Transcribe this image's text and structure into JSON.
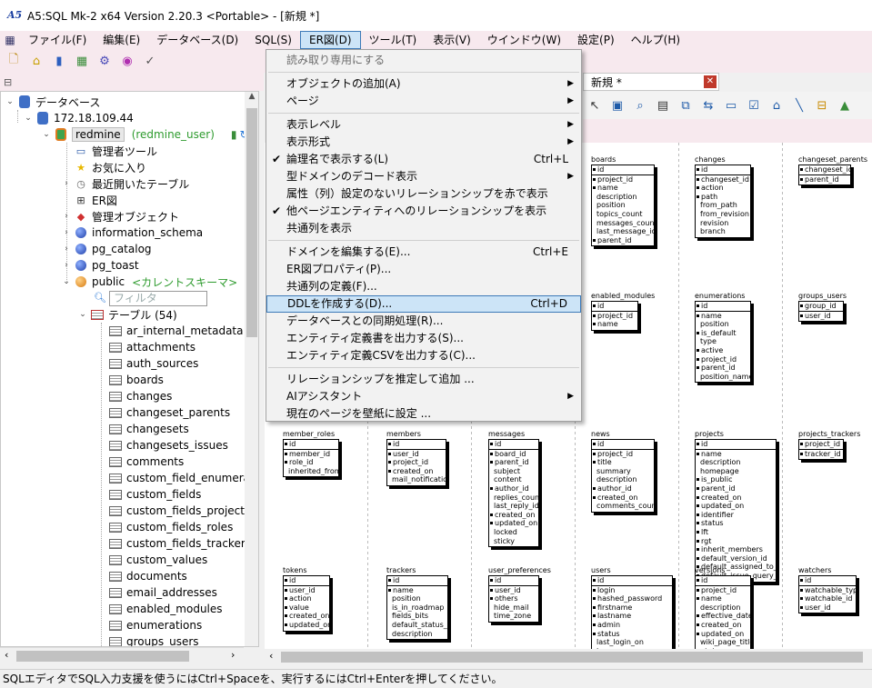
{
  "window": {
    "title": "A5:SQL Mk-2 x64 Version 2.20.3 <Portable> - [新規 *]"
  },
  "menubar": [
    "ファイル(F)",
    "編集(E)",
    "データベース(D)",
    "SQL(S)",
    "ER図(D)",
    "ツール(T)",
    "表示(V)",
    "ウインドウ(W)",
    "設定(P)",
    "ヘルプ(H)"
  ],
  "tree": {
    "root": "データベース",
    "host": "172.18.109.44",
    "connection": "redmine",
    "connection_user": "(redmine_user)",
    "items": [
      "管理者ツール",
      "お気に入り",
      "最近開いたテーブル",
      "ER図",
      "管理オブジェクト"
    ],
    "schemas": [
      "information_schema",
      "pg_catalog",
      "pg_toast"
    ],
    "current_schema": "public",
    "current_schema_note": "<カレントスキーマ>",
    "filter_placeholder": "フィルタ",
    "tables_label": "テーブル (54)",
    "tables": [
      "ar_internal_metadata",
      "attachments",
      "auth_sources",
      "boards",
      "changes",
      "changeset_parents",
      "changesets",
      "changesets_issues",
      "comments",
      "custom_field_enumerat",
      "custom_fields",
      "custom_fields_projects",
      "custom_fields_roles",
      "custom_fields_trackers",
      "custom_values",
      "documents",
      "email_addresses",
      "enabled_modules",
      "enumerations",
      "groups_users"
    ]
  },
  "tab": {
    "label": "新規 *"
  },
  "dropdown": [
    {
      "label": "読み取り専用にする",
      "disabled": true
    },
    {
      "sep": true
    },
    {
      "label": "オブジェクトの追加(A)",
      "submenu": true
    },
    {
      "label": "ページ",
      "submenu": true
    },
    {
      "sep": true
    },
    {
      "label": "表示レベル",
      "submenu": true
    },
    {
      "label": "表示形式",
      "submenu": true
    },
    {
      "label": "論理名で表示する(L)",
      "shortcut": "Ctrl+L",
      "checked": true
    },
    {
      "label": "型ドメインのデコード表示",
      "submenu": true
    },
    {
      "label": "属性（列）設定のないリレーションシップを赤で表示"
    },
    {
      "label": "他ページエンティティへのリレーションシップを表示",
      "checked": true
    },
    {
      "label": "共通列を表示"
    },
    {
      "sep": true
    },
    {
      "label": "ドメインを編集する(E)...",
      "shortcut": "Ctrl+E"
    },
    {
      "label": "ER図プロパティ(P)..."
    },
    {
      "label": "共通列の定義(F)..."
    },
    {
      "label": "DDLを作成する(D)...",
      "shortcut": "Ctrl+D",
      "highlighted": true
    },
    {
      "label": "データベースとの同期処理(R)..."
    },
    {
      "label": "エンティティ定義書を出力する(S)..."
    },
    {
      "label": "エンティティ定義CSVを出力する(C)..."
    },
    {
      "sep": true
    },
    {
      "label": "リレーションシップを推定して追加 ..."
    },
    {
      "label": "AIアシスタント",
      "submenu": true
    },
    {
      "label": "現在のページを壁紙に設定 ..."
    }
  ],
  "entities": [
    {
      "name": "boards",
      "cols": [
        "id",
        "project_id",
        "name",
        "description",
        "position",
        "topics_count",
        "messages_count",
        "last_message_id",
        "parent_id"
      ]
    },
    {
      "name": "changes",
      "cols": [
        "id",
        "changeset_id",
        "action",
        "path",
        "from_path",
        "from_revision",
        "revision",
        "branch"
      ]
    },
    {
      "name": "changeset_parents",
      "cols": [
        "changeset_id",
        "parent_id"
      ]
    },
    {
      "name": "enabled_modules",
      "cols": [
        "id",
        "project_id",
        "name"
      ]
    },
    {
      "name": "enumerations",
      "cols": [
        "id",
        "name",
        "position",
        "is_default",
        "type",
        "active",
        "project_id",
        "parent_id",
        "position_name"
      ]
    },
    {
      "name": "groups_users",
      "cols": [
        "group_id",
        "user_id"
      ]
    },
    {
      "name": "member_roles",
      "cols": [
        "id",
        "member_id",
        "role_id",
        "inherited_from"
      ]
    },
    {
      "name": "members",
      "cols": [
        "id",
        "user_id",
        "project_id",
        "created_on",
        "mail_notification"
      ]
    },
    {
      "name": "messages",
      "cols": [
        "id",
        "board_id",
        "parent_id",
        "subject",
        "content",
        "author_id",
        "replies_count",
        "last_reply_id",
        "created_on",
        "updated_on",
        "locked",
        "sticky"
      ]
    },
    {
      "name": "news",
      "cols": [
        "id",
        "project_id",
        "title",
        "summary",
        "description",
        "author_id",
        "created_on",
        "comments_count"
      ]
    },
    {
      "name": "projects",
      "cols": [
        "id",
        "name",
        "description",
        "homepage",
        "is_public",
        "parent_id",
        "created_on",
        "updated_on",
        "identifier",
        "status",
        "lft",
        "rgt",
        "inherit_members",
        "default_version_id",
        "default_assigned_to_id",
        "default_issue_query_id"
      ]
    },
    {
      "name": "projects_trackers",
      "cols": [
        "project_id",
        "tracker_id"
      ]
    },
    {
      "name": "tokens",
      "cols": [
        "id",
        "user_id",
        "action",
        "value",
        "created_on",
        "updated_on"
      ]
    },
    {
      "name": "trackers",
      "cols": [
        "id",
        "name",
        "position",
        "is_in_roadmap",
        "fields_bits",
        "default_status_id",
        "description"
      ]
    },
    {
      "name": "user_preferences",
      "cols": [
        "id",
        "user_id",
        "others",
        "hide_mail",
        "time_zone"
      ]
    },
    {
      "name": "users",
      "cols": [
        "id",
        "login",
        "hashed_password",
        "firstname",
        "lastname",
        "admin",
        "status",
        "last_login_on",
        "language"
      ]
    },
    {
      "name": "versions",
      "cols": [
        "id",
        "project_id",
        "name",
        "description",
        "effective_date",
        "created_on",
        "updated_on",
        "wiki_page_title",
        "status"
      ]
    },
    {
      "name": "watchers",
      "cols": [
        "id",
        "watchable_type",
        "watchable_id",
        "user_id"
      ]
    }
  ],
  "statusbar": "SQLエディタでSQL入力支援を使うにはCtrl+Spaceを、実行するにはCtrl+Enterを押してください。"
}
